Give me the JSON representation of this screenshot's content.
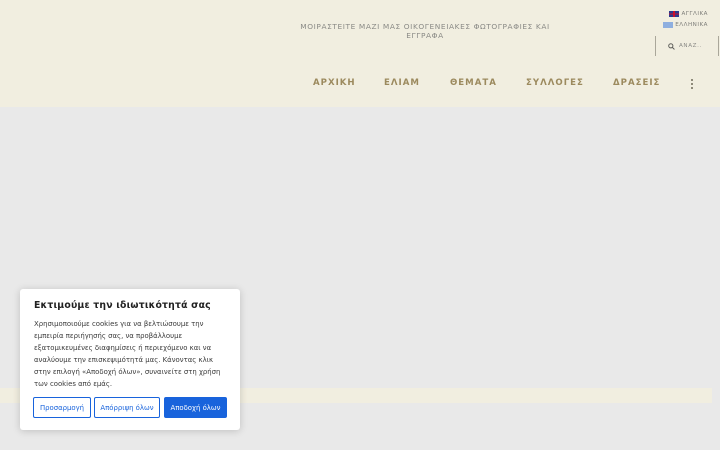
{
  "header": {
    "tagline": "ΜΟΙΡΑΣΤΕΙΤΕ ΜΑΖΙ ΜΑΣ ΟΙΚΟΓΕΝΕΙΑΚΕΣ ΦΩΤΟΓΡΑΦΙΕΣ ΚΑΙ ΕΓΓΡΑΦΑ",
    "languages": [
      {
        "label": "ΑΓΓΛΙΚΑ",
        "icon": "uk-flag-icon"
      },
      {
        "label": "ΕΛΛΗΝΙΚΑ",
        "icon": "greek-flag-icon"
      }
    ],
    "search": {
      "placeholder": "ΑΝΑΖ..",
      "icon": "search-icon"
    }
  },
  "nav": {
    "items": [
      "ΑΡΧΙΚΗ",
      "ΕΛΙΑΜ",
      "ΘΕΜΑΤΑ",
      "ΣΥΛΛΟΓΕΣ",
      "ΔΡΑΣΕΙΣ"
    ],
    "more_icon": "kebab-menu-icon"
  },
  "cookie_banner": {
    "title": "Εκτιμούμε την ιδιωτικότητά σας",
    "text": "Χρησιμοποιούμε cookies για να βελτιώσουμε την εμπειρία περιήγησής σας, να προβάλλουμε εξατομικευμένες διαφημίσεις ή περιεχόμενο και να αναλύουμε την επισκεψιμότητά μας. Κάνοντας κλικ στην επιλογή «Αποδοχή όλων», συναινείτε στη χρήση των cookies από εμάς.",
    "buttons": {
      "customize": "Προσαρμογή",
      "reject": "Απόρριψη όλων",
      "accept": "Αποδοχή όλων"
    }
  },
  "colors": {
    "header_bg": "#f1eee0",
    "nav_text": "#9c8a5e",
    "accent": "#1863dc",
    "page_bg": "#e9e9e9"
  }
}
